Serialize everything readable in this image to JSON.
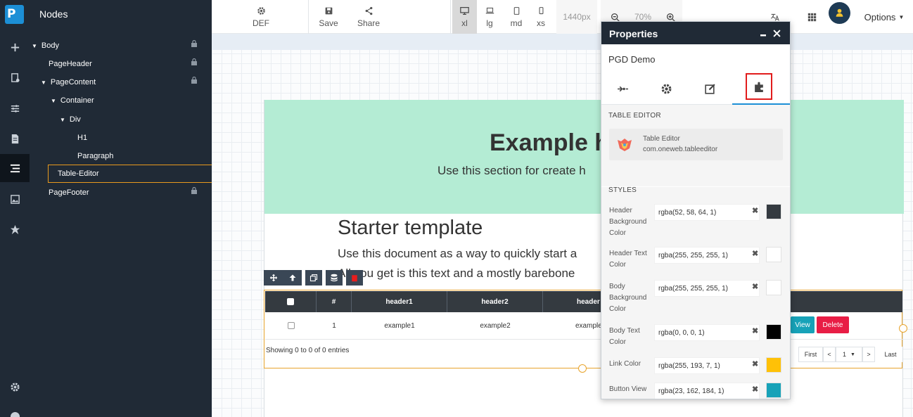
{
  "app": {
    "logo_text": "P"
  },
  "nodes_panel": {
    "title": "Nodes",
    "items": [
      {
        "label": "Body",
        "has_caret": true,
        "locked": true
      },
      {
        "label": "PageHeader",
        "has_caret": false,
        "locked": true
      },
      {
        "label": "PageContent",
        "has_caret": true,
        "locked": true
      },
      {
        "label": "Container",
        "has_caret": true,
        "locked": false
      },
      {
        "label": "Div",
        "has_caret": true,
        "locked": false
      },
      {
        "label": "H1",
        "has_caret": false,
        "locked": false
      },
      {
        "label": "Paragraph",
        "has_caret": false,
        "locked": false
      },
      {
        "label": "Table-Editor",
        "has_caret": false,
        "locked": false,
        "selected": true
      },
      {
        "label": "PageFooter",
        "has_caret": false,
        "locked": true
      }
    ]
  },
  "toolbar": {
    "def_label": "DEF",
    "save_label": "Save",
    "share_label": "Share",
    "breakpoints": [
      "xl",
      "lg",
      "md",
      "xs"
    ],
    "active_breakpoint": "xl",
    "width_readout": "1440px",
    "zoom": "70%",
    "options_label": "Options"
  },
  "canvas": {
    "hero_title": "Example h",
    "hero_sub": "Use this section for create h",
    "starter_title": "Starter template",
    "starter_line1": "Use this document as a way to quickly start a",
    "starter_line2": "All you get is this text and a mostly barebone"
  },
  "table_editor": {
    "columns": [
      "#",
      "header1",
      "header2",
      "header3"
    ],
    "header_fragment": "header",
    "row": {
      "index": "1",
      "cells": [
        "example1",
        "example2",
        "example"
      ]
    },
    "view_label": "View",
    "delete_label": "Delete",
    "showing": "Showing 0 to 0 of 0 entries",
    "pager": {
      "first": "First",
      "prev": "<",
      "page": "1",
      "next": ">",
      "last": "Last"
    }
  },
  "properties": {
    "title": "Properties",
    "project": "PGD Demo",
    "section_table": "TABLE EDITOR",
    "plugin_name": "Table Editor",
    "plugin_id": "com.oneweb.tableeditor",
    "section_styles": "STYLES",
    "styles": [
      {
        "label": "Header Background Color",
        "value": "rgba(52, 58, 64, 1)",
        "color": "#343a40"
      },
      {
        "label": "Header Text Color",
        "value": "rgba(255, 255, 255, 1)",
        "color": "#ffffff"
      },
      {
        "label": "Body Background Color",
        "value": "rgba(255, 255, 255, 1)",
        "color": "#ffffff"
      },
      {
        "label": "Body Text Color",
        "value": "rgba(0, 0, 0, 1)",
        "color": "#000000"
      },
      {
        "label": "Link Color",
        "value": "rgba(255, 193, 7, 1)",
        "color": "#ffc107"
      },
      {
        "label": "Button View",
        "value": "rgba(23, 162, 184, 1)",
        "color": "#17a2b8"
      }
    ]
  },
  "colors": {
    "sidebar_bg": "#202a36",
    "selection_accent": "#e89a1d",
    "highlight_box": "#e11c1c",
    "hero_bg": "#b4ecd4"
  }
}
